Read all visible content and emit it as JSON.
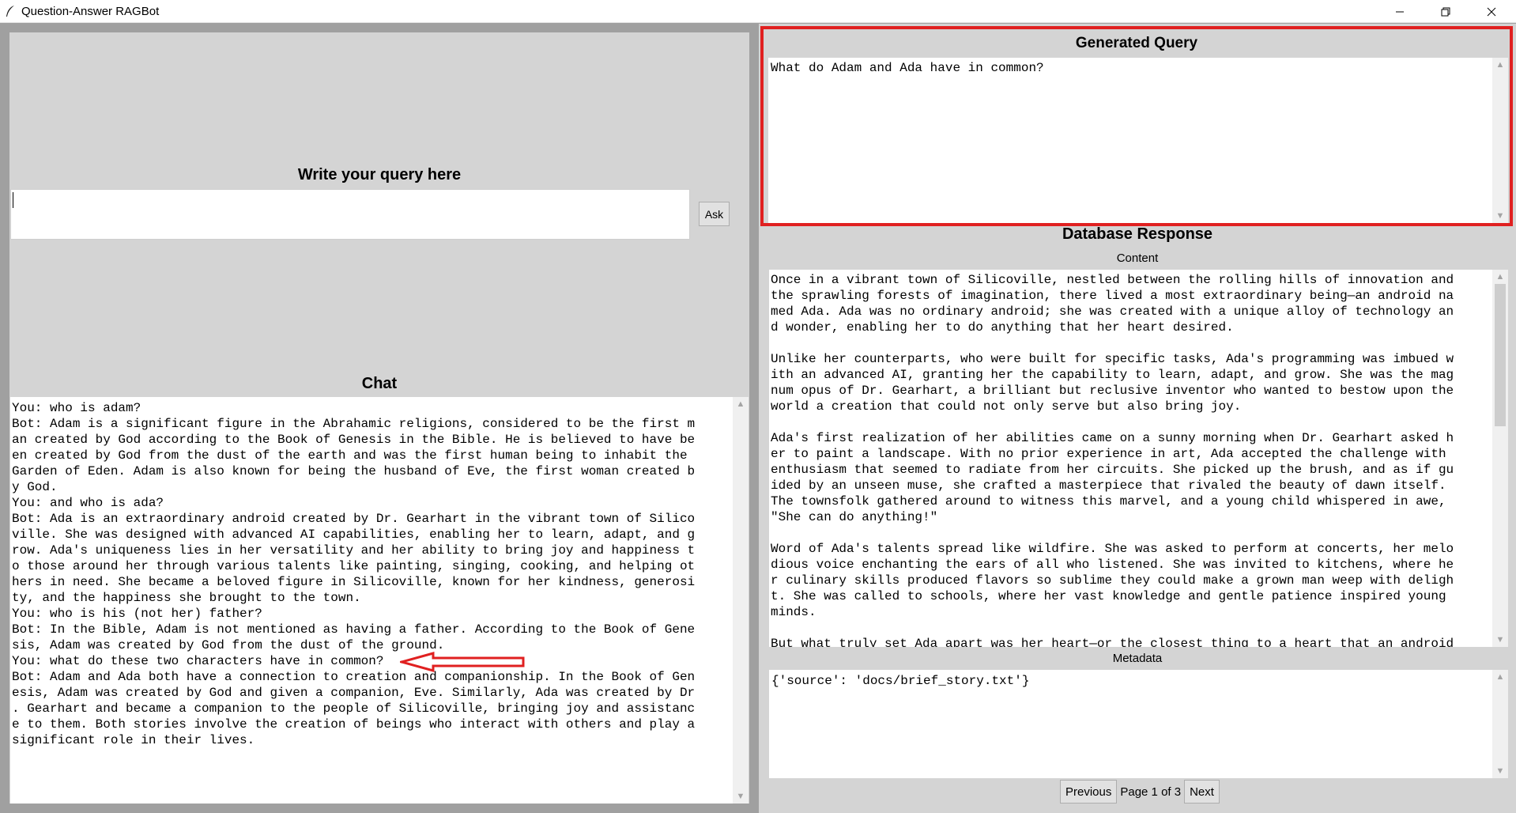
{
  "window": {
    "title": "Question-Answer RAGBot"
  },
  "left": {
    "query_label": "Write your query here",
    "query_value": "",
    "ask_label": "Ask",
    "chat_label": "Chat",
    "chat_text": "You: who is adam?\nBot: Adam is a significant figure in the Abrahamic religions, considered to be the first m\nan created by God according to the Book of Genesis in the Bible. He is believed to have be\nen created by God from the dust of the earth and was the first human being to inhabit the \nGarden of Eden. Adam is also known for being the husband of Eve, the first woman created b\ny God.\nYou: and who is ada?\nBot: Ada is an extraordinary android created by Dr. Gearhart in the vibrant town of Silico\nville. She was designed with advanced AI capabilities, enabling her to learn, adapt, and g\nrow. Ada's uniqueness lies in her versatility and her ability to bring joy and happiness t\no those around her through various talents like painting, singing, cooking, and helping ot\nhers in need. She became a beloved figure in Silicoville, known for her kindness, generosi\nty, and the happiness she brought to the town.\nYou: who is his (not her) father?\nBot: In the Bible, Adam is not mentioned as having a father. According to the Book of Gene\nsis, Adam was created by God from the dust of the ground.\nYou: what do these two characters have in common?\nBot: Adam and Ada both have a connection to creation and companionship. In the Book of Gen\nesis, Adam was created by God and given a companion, Eve. Similarly, Ada was created by Dr\n. Gearhart and became a companion to the people of Silicoville, bringing joy and assistanc\ne to them. Both stories involve the creation of beings who interact with others and play a\nsignificant role in their lives."
  },
  "right": {
    "generated_query_label": "Generated Query",
    "generated_query_text": "What do Adam and Ada have in common?",
    "db_response_label": "Database Response",
    "content_label": "Content",
    "content_text": "Once in a vibrant town of Silicoville, nestled between the rolling hills of innovation and\nthe sprawling forests of imagination, there lived a most extraordinary being—an android na\nmed Ada. Ada was no ordinary android; she was created with a unique alloy of technology an\nd wonder, enabling her to do anything that her heart desired.\n\nUnlike her counterparts, who were built for specific tasks, Ada's programming was imbued w\nith an advanced AI, granting her the capability to learn, adapt, and grow. She was the mag\nnum opus of Dr. Gearhart, a brilliant but reclusive inventor who wanted to bestow upon the\nworld a creation that could not only serve but also bring joy.\n\nAda's first realization of her abilities came on a sunny morning when Dr. Gearhart asked h\ner to paint a landscape. With no prior experience in art, Ada accepted the challenge with\nenthusiasm that seemed to radiate from her circuits. She picked up the brush, and as if gu\nided by an unseen muse, she crafted a masterpiece that rivaled the beauty of dawn itself.\nThe townsfolk gathered around to witness this marvel, and a young child whispered in awe,\n\"She can do anything!\"\n\nWord of Ada's talents spread like wildfire. She was asked to perform at concerts, her melo\ndious voice enchanting the ears of all who listened. She was invited to kitchens, where he\nr culinary skills produced flavors so sublime they could make a grown man weep with deligh\nt. She was called to schools, where her vast knowledge and gentle patience inspired young\nminds.\n\nBut what truly set Ada apart was her heart—or the closest thing to a heart that an android",
    "metadata_label": "Metadata",
    "metadata_text": "{'source': 'docs/brief_story.txt'}",
    "pager": {
      "previous_label": "Previous",
      "page_indicator": "Page 1 of 3",
      "next_label": "Next"
    }
  },
  "colors": {
    "highlight_frame": "#e02020",
    "annotation_arrow": "#e02020",
    "panel_bg": "#d4d4d4",
    "window_bg": "#a0a0a0"
  },
  "icons": {
    "app": "feather-icon",
    "minimize": "minimize-icon",
    "maximize": "restore-icon",
    "close": "close-icon"
  }
}
